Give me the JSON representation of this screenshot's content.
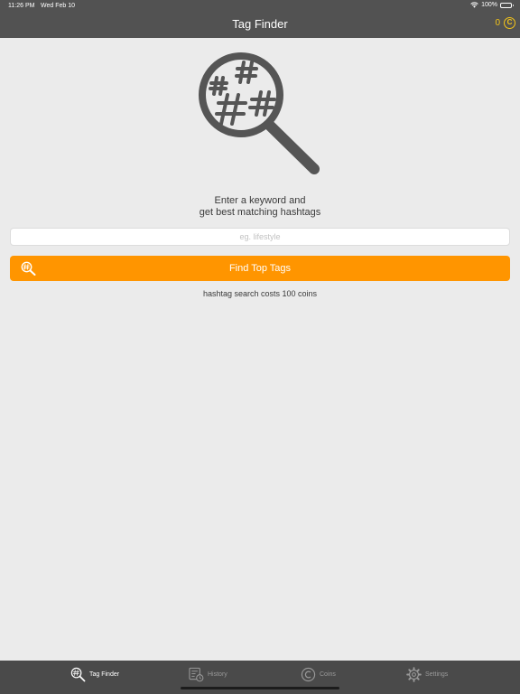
{
  "status_bar": {
    "time": "11:26 PM",
    "date": "Wed Feb 10",
    "battery": "100%"
  },
  "nav": {
    "title": "Tag Finder",
    "coin_balance": "0",
    "coin_symbol": "C"
  },
  "main": {
    "prompt_line1": "Enter a keyword and",
    "prompt_line2": "get best matching hashtags",
    "keyword_placeholder": "eg. lifestyle",
    "keyword_value": "",
    "find_button_label": "Find Top Tags",
    "cost_note": "hashtag search costs 100 coins"
  },
  "tabs": [
    {
      "label": "Tag Finder",
      "icon": "hashtag-search-icon",
      "active": true
    },
    {
      "label": "History",
      "icon": "history-icon",
      "active": false
    },
    {
      "label": "Coins",
      "icon": "coin-icon",
      "active": false
    },
    {
      "label": "Settings",
      "icon": "gear-icon",
      "active": false
    }
  ],
  "colors": {
    "nav_background": "#525252",
    "background": "#ebebeb",
    "accent": "#ff9500",
    "coin": "#f5c518",
    "tabbar_background": "#4a4a4a"
  }
}
